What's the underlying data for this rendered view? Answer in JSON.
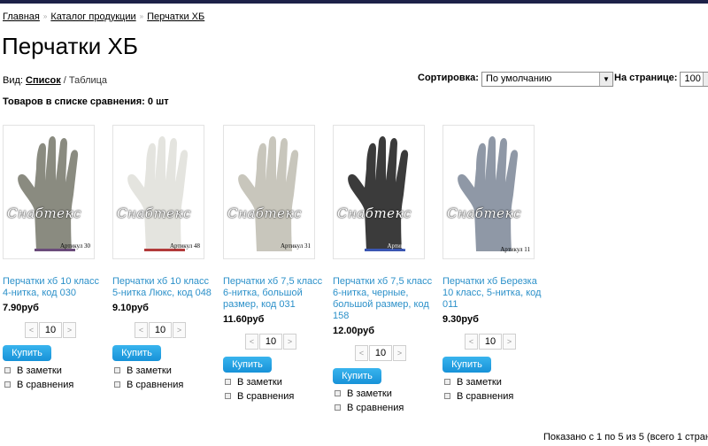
{
  "breadcrumb": {
    "home": "Главная",
    "catalog": "Каталог продукции",
    "current": "Перчатки ХБ"
  },
  "page_title": "Перчатки ХБ",
  "view": {
    "label": "Вид:",
    "list": "Список",
    "divider": "/",
    "table": "Таблица"
  },
  "sort": {
    "label": "Сортировка:",
    "value": "По умолчанию"
  },
  "per_page": {
    "label": "На странице:",
    "value": "100"
  },
  "compare_text": "Товаров в списке сравнения: 0 шт",
  "watermark": "Снабтекс",
  "buttons": {
    "buy": "Купить",
    "minus": "<",
    "plus": ">"
  },
  "options": {
    "notes": "В заметки",
    "compare": "В сравнения"
  },
  "products": [
    {
      "name": "Перчатки хб 10 класс 4-нитка, код 030",
      "price": "7.90руб",
      "qty": "10",
      "article": "Артикул 30",
      "color": "#8a8b80"
    },
    {
      "name": "Перчатки хб 10 класс 5-нитка Люкс, код 048",
      "price": "9.10руб",
      "qty": "10",
      "article": "Артикул 48",
      "color": "#e4e4df"
    },
    {
      "name": "Перчатки хб 7,5 класс 6-нитка, большой размер, код 031",
      "price": "11.60руб",
      "qty": "10",
      "article": "Артикул 31",
      "color": "#c8c6bc"
    },
    {
      "name": "Перчатки хб 7,5 класс 6-нитка, черные, большой размер, код 158",
      "price": "12.00руб",
      "qty": "10",
      "article": "Артикул 158",
      "color": "#3b3b3b"
    },
    {
      "name": "Перчатки хб Березка 10 класс, 5-нитка, код 011",
      "price": "9.30руб",
      "qty": "10",
      "article": "Артикул 11",
      "color": "#8f98a6"
    }
  ],
  "pagination_summary": "Показано с 1 по 5 из 5 (всего 1 страниц)"
}
